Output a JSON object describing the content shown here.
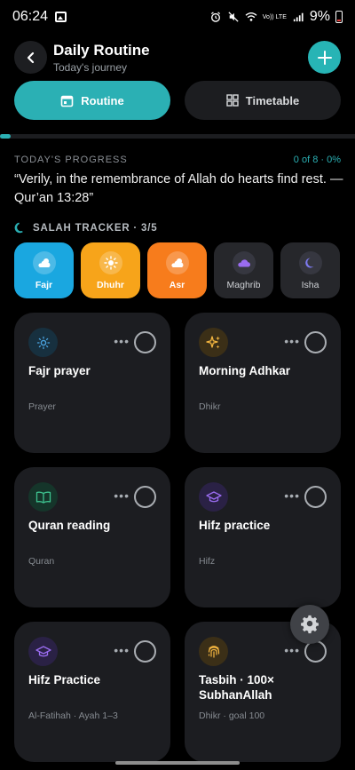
{
  "status_bar": {
    "time": "06:24",
    "battery": "9%",
    "network": "Vo)) LTE"
  },
  "header": {
    "title": "Daily Routine",
    "subtitle": "Today's journey"
  },
  "tabs": [
    {
      "label": "Routine",
      "active": true
    },
    {
      "label": "Timetable",
      "active": false
    }
  ],
  "progress": {
    "label": "TODAY'S PROGRESS",
    "count": "0 of 8 · 0%",
    "fraction": 0.0
  },
  "quote": "“Verily, in the remembrance of Allah do hearts find rest. — Qur’an 13:28”",
  "salah": {
    "label": "SALAH TRACKER · 3/5",
    "prayers": [
      {
        "name": "Fajr",
        "icon": "cloud-sun-icon",
        "done": true,
        "color": "#1aa7e0"
      },
      {
        "name": "Dhuhr",
        "icon": "sun-icon",
        "done": true,
        "color": "#f7a41a"
      },
      {
        "name": "Asr",
        "icon": "cloud-sun-icon",
        "done": true,
        "color": "#f77c1c"
      },
      {
        "name": "Maghrib",
        "icon": "cloud-icon",
        "done": false,
        "color": "#26272b"
      },
      {
        "name": "Isha",
        "icon": "moon-icon",
        "done": false,
        "color": "#26272b"
      }
    ]
  },
  "cards": [
    {
      "name": "Fajr prayer",
      "meta": "Prayer",
      "icon": "sun-icon",
      "icon_color": "#4aa3e0"
    },
    {
      "name": "Morning Adhkar",
      "meta": "Dhikr",
      "icon": "sparkles-icon",
      "icon_color": "#f5b740"
    },
    {
      "name": "Quran reading",
      "meta": "Quran",
      "icon": "book-open-icon",
      "icon_color": "#3ec28f"
    },
    {
      "name": "Hifz practice",
      "meta": "Hifz",
      "icon": "graduation-cap-icon",
      "icon_color": "#9a6cf0"
    },
    {
      "name": "Hifz Practice",
      "meta": "Al-Fatihah · Ayah 1–3",
      "icon": "graduation-cap-icon",
      "icon_color": "#9a6cf0"
    },
    {
      "name": "Tasbih · 100× SubhanAllah",
      "meta": "Dhikr · goal 100",
      "icon": "fingerprint-icon",
      "icon_color": "#f5b740"
    }
  ],
  "colors": {
    "accent": "#2bb0b4",
    "background": "#000000",
    "card": "#1c1d21"
  }
}
